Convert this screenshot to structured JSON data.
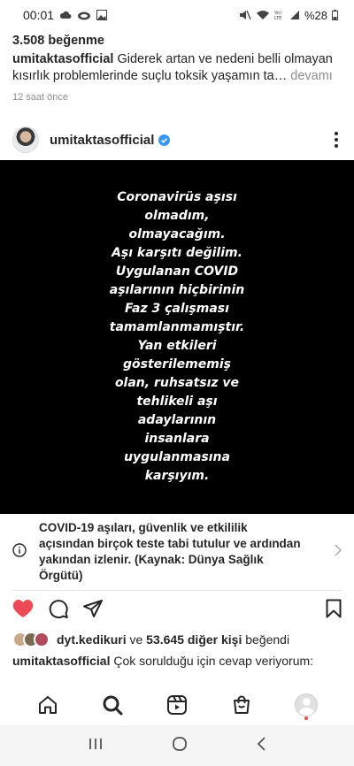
{
  "status_bar": {
    "time": "00:01",
    "battery": "%28"
  },
  "previous_post": {
    "likes": "3.508 beğenme",
    "username": "umitaktasofficial",
    "caption_text": "Giderek artan ve nedeni belli olmayan kısırlık problemlerinde suçlu toksik yaşamın ta…",
    "more_label": "devamı",
    "time": "12 saat önce"
  },
  "post": {
    "username": "umitaktasofficial",
    "image_text": "Coronavirüs aşısı\nolmadım,\nolmayacağım.\nAşı karşıtı değilim.\nUygulanan COVID\naşılarının hiçbirinin\nFaz 3 çalışması\ntamamlanmamıştır.\nYan etkileri\ngösterilememiş\nolan, ruhsatsız ve\ntehlikeli aşı\nadaylarının\ninsanlara\nuygulanmasına\nkarşıyım.",
    "info_banner": "COVID-19 aşıları, güvenlik ve etkililik açısından birçok teste tabi tutulur ve ardından yakından izlenir. (Kaynak: Dünya Sağlık Örgütü)",
    "liked_by_user": "dyt.kedikuri",
    "liked_by_conj": "ve",
    "liked_by_others": "53.645 diğer kişi",
    "liked_by_suffix": "beğendi",
    "caption_username": "umitaktasofficial",
    "caption_text": "Çok sorulduğu için cevap veriyorum:"
  },
  "colors": {
    "like_red": "#ed4956",
    "verified_blue": "#3897f0",
    "text": "#262626",
    "muted": "#8e8e8e"
  },
  "icons": {
    "bottom_nav": [
      "home-icon",
      "search-icon",
      "reels-icon",
      "shop-icon",
      "profile-icon"
    ],
    "android_nav": [
      "recent-apps-icon",
      "home-circle-icon",
      "back-icon"
    ]
  }
}
